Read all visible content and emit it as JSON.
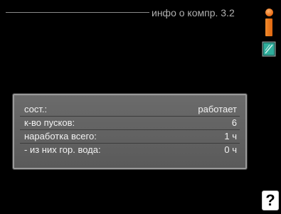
{
  "header": {
    "title": "инфо о компр. 3.2",
    "info_icon": "info-icon",
    "book_icon": "manual-book-icon"
  },
  "panel": {
    "rows": [
      {
        "label": "сост.:",
        "value": "работает"
      },
      {
        "label": "к-во пусков:",
        "value": "6"
      },
      {
        "label": "наработка всего:",
        "value": "1 ч"
      },
      {
        "label": "- из них гор. вода:",
        "value": "0 ч"
      }
    ]
  },
  "help": {
    "label": "?"
  },
  "colors": {
    "background": "#000000",
    "panel": "#636363",
    "accent": "#e87a20",
    "book": "#2a9a8a"
  }
}
